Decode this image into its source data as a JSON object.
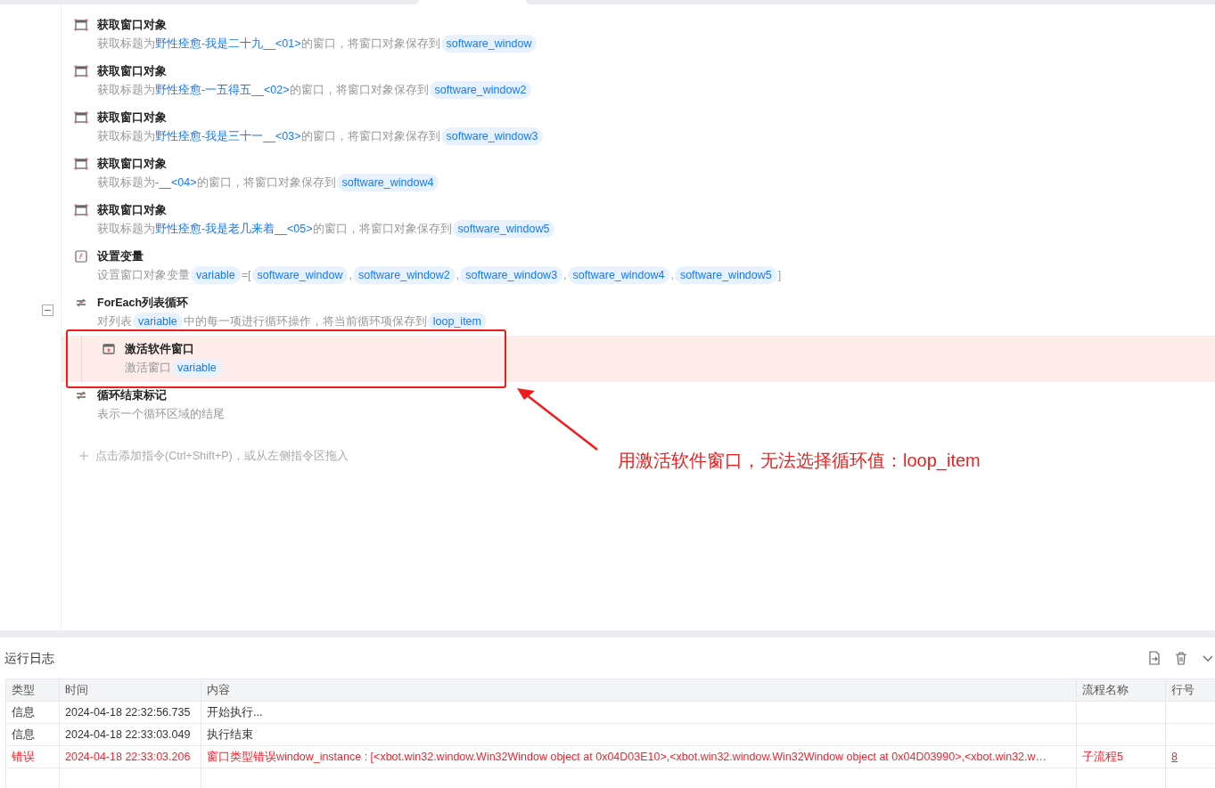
{
  "steps": [
    {
      "kind": "window",
      "title": "获取窗口对象",
      "highlighted": false,
      "description": [
        {
          "kind": "text",
          "text": "获取标题为"
        },
        {
          "kind": "link",
          "text": "野性痊愈-我是二十九__<01>"
        },
        {
          "kind": "text",
          "text": "的窗口，将窗口对象保存到"
        },
        {
          "kind": "var",
          "text": "software_window"
        }
      ]
    },
    {
      "kind": "window",
      "title": "获取窗口对象",
      "highlighted": false,
      "description": [
        {
          "kind": "text",
          "text": "获取标题为"
        },
        {
          "kind": "link",
          "text": "野性痊愈-一五得五__<02>"
        },
        {
          "kind": "text",
          "text": "的窗口，将窗口对象保存到"
        },
        {
          "kind": "var",
          "text": "software_window2"
        }
      ]
    },
    {
      "kind": "window",
      "title": "获取窗口对象",
      "highlighted": false,
      "description": [
        {
          "kind": "text",
          "text": "获取标题为"
        },
        {
          "kind": "link",
          "text": "野性痊愈-我是三十一__<03>"
        },
        {
          "kind": "text",
          "text": "的窗口，将窗口对象保存到"
        },
        {
          "kind": "var",
          "text": "software_window3"
        }
      ]
    },
    {
      "kind": "window",
      "title": "获取窗口对象",
      "highlighted": false,
      "description": [
        {
          "kind": "text",
          "text": "获取标题为"
        },
        {
          "kind": "link",
          "text": "-__<04>"
        },
        {
          "kind": "text",
          "text": "的窗口，将窗口对象保存到"
        },
        {
          "kind": "var",
          "text": "software_window4"
        }
      ]
    },
    {
      "kind": "window",
      "title": "获取窗口对象",
      "highlighted": false,
      "description": [
        {
          "kind": "text",
          "text": "获取标题为"
        },
        {
          "kind": "link",
          "text": "野性痊愈-我是老几来着__<05>"
        },
        {
          "kind": "text",
          "text": "的窗口，将窗口对象保存到"
        },
        {
          "kind": "var",
          "text": "software_window5"
        }
      ]
    },
    {
      "kind": "formula",
      "title": "设置变量",
      "highlighted": false,
      "description": [
        {
          "kind": "text",
          "text": "设置窗口对象变量"
        },
        {
          "kind": "var",
          "text": "variable"
        },
        {
          "kind": "text",
          "text": "=["
        },
        {
          "kind": "var",
          "text": "software_window"
        },
        {
          "kind": "text",
          "text": ","
        },
        {
          "kind": "var",
          "text": "software_window2"
        },
        {
          "kind": "text",
          "text": ","
        },
        {
          "kind": "var",
          "text": "software_window3"
        },
        {
          "kind": "text",
          "text": ","
        },
        {
          "kind": "var",
          "text": "software_window4"
        },
        {
          "kind": "text",
          "text": ","
        },
        {
          "kind": "var",
          "text": "software_window5"
        },
        {
          "kind": "text",
          "text": "]"
        }
      ]
    },
    {
      "kind": "loop",
      "title": "ForEach列表循环",
      "highlighted": false,
      "expanded": true,
      "description": [
        {
          "kind": "text",
          "text": "对列表"
        },
        {
          "kind": "var",
          "text": "variable"
        },
        {
          "kind": "text",
          "text": "中的每一项进行循环操作，将当前循环项保存到"
        },
        {
          "kind": "var",
          "text": "loop_item"
        }
      ],
      "children": [
        {
          "kind": "activate",
          "title": "激活软件窗口",
          "highlighted": true,
          "description": [
            {
              "kind": "text",
              "text": "激活窗口"
            },
            {
              "kind": "var",
              "text": "variable"
            }
          ]
        }
      ]
    },
    {
      "kind": "loop-end",
      "title": "循环结束标记",
      "highlighted": false,
      "description": [
        {
          "kind": "text",
          "text": "表示一个循环区域的结尾"
        }
      ]
    }
  ],
  "add_hint": "点击添加指令(Ctrl+Shift+P)，或从左侧指令区拖入",
  "annotation": {
    "text": "用激活软件窗口，无法选择循环值：loop_item"
  },
  "log": {
    "title": "运行日志",
    "columns": [
      "类型",
      "时间",
      "内容",
      "流程名称",
      "行号"
    ],
    "rows": [
      {
        "kind": "info",
        "type": "信息",
        "time": "2024-04-18 22:32:56.735",
        "content": "开始执行..."
      },
      {
        "kind": "info",
        "type": "信息",
        "time": "2024-04-18 22:33:03.049",
        "content": "执行结束"
      },
      {
        "kind": "error",
        "type": "错误",
        "time": "2024-04-18 22:33:03.206",
        "content": "窗口类型错误window_instance : [<xbot.win32.window.Win32Window object at 0x04D03E10>,<xbot.win32.window.Win32Window object at 0x04D03990>,<xbot.win32.w…",
        "flow": "子流程5",
        "line": "8"
      }
    ]
  }
}
